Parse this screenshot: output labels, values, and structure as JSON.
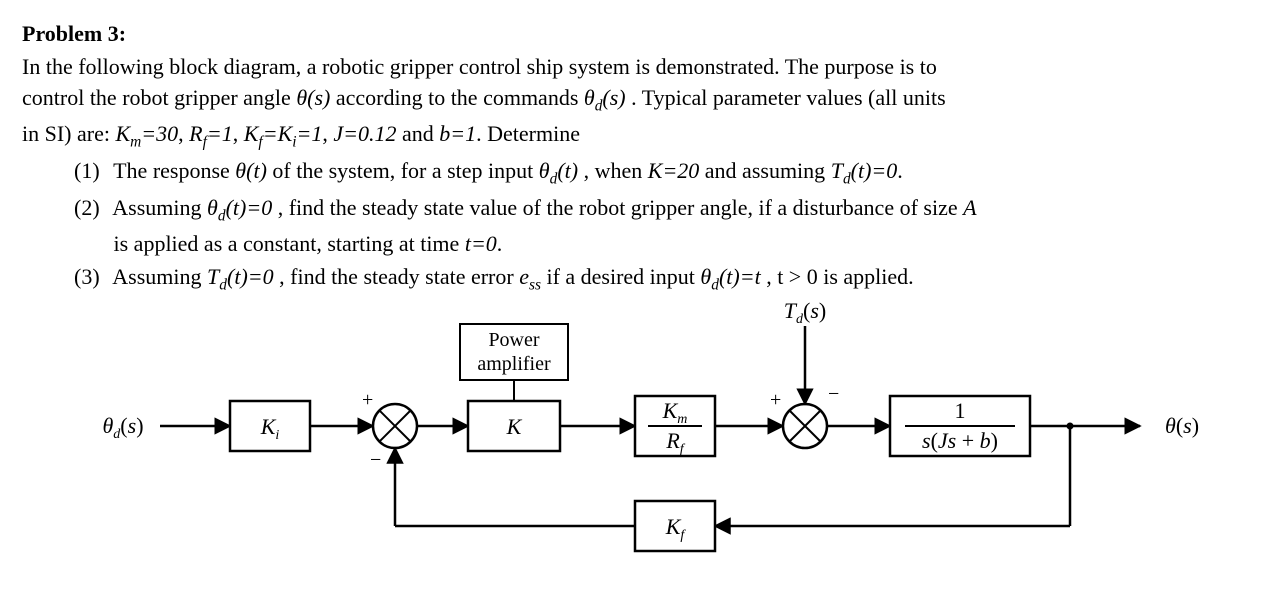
{
  "title": "Problem 3:",
  "para_line1_a": "In the following block diagram, a robotic gripper control ship system is demonstrated. The purpose is to",
  "para_line2_a": "control the robot gripper angle ",
  "para_line2_theta_s": "θ(s)",
  "para_line2_b": " according to the commands ",
  "para_line2_theta_d_s": "θ_d(s)",
  "para_line2_c": ". Typical parameter values (all units",
  "para_line3_a": "in SI) are: ",
  "params": {
    "Km": "K_m=30",
    "Rf": "R_f=1",
    "KfKi": "K_f=K_i=1",
    "J": "J=0.12",
    "b": "b=1"
  },
  "para_line3_b": ". Determine",
  "q1": {
    "num": "(1)",
    "a": "The response ",
    "theta_t": "θ(t)",
    "b": " of the system, for a step input ",
    "theta_d_t": "θ_d(t)",
    "c": ", when ",
    "K20": "K=20",
    "d": " and assuming ",
    "Td0": "T_d(t)=0",
    "e": "."
  },
  "q2": {
    "num": "(2)",
    "a": "Assuming ",
    "theta_d0": "θ_d(t)=0",
    "b": ", find the steady state value of the robot gripper angle, if a disturbance of size ",
    "A": "A",
    "line2": "is applied as a constant, starting at time ",
    "t0": "t=0",
    "dot": "."
  },
  "q3": {
    "num": "(3)",
    "a": "Assuming ",
    "Td0": "T_d(t)=0",
    "b": ", find the steady state error ",
    "ess": "e_ss",
    "c": " if a desired input ",
    "theta_d_t": "θ_d(t)=t",
    "d": ", t > 0 is applied."
  },
  "diagram": {
    "input_label": "θ_d(s)",
    "Ki": "K_i",
    "sum1": {
      "plus": "+",
      "minus": "−"
    },
    "amp_top": "Power",
    "amp_bot": "amplifier",
    "K": "K",
    "Km_over_Rf_top": "K_m",
    "Km_over_Rf_bot": "R_f",
    "sum2": {
      "plus": "+",
      "minus": "−"
    },
    "Td_label": "T_d(s)",
    "plant_top": "1",
    "plant_bot": "s(Js + b)",
    "output_label": "θ(s)",
    "Kf": "K_f"
  },
  "chart_data": {
    "type": "block-diagram",
    "signals": {
      "input": "θ_d(s)",
      "disturbance": "T_d(s)",
      "output": "θ(s)"
    },
    "forward_path": [
      {
        "block": "K_i"
      },
      {
        "sum": {
          "inputs": [
            "+ (from K_i)",
            "− (feedback from K_f)"
          ]
        }
      },
      {
        "block": "K",
        "label": "Power amplifier"
      },
      {
        "block": "K_m / R_f"
      },
      {
        "sum": {
          "inputs": [
            "+ (from K_m/R_f)",
            "− T_d(s)"
          ]
        }
      },
      {
        "block": "1 / ( s (J s + b) )"
      }
    ],
    "feedback_path": [
      {
        "block": "K_f",
        "from": "θ(s)",
        "to": "negative input of first summing junction"
      }
    ],
    "parameters": {
      "K_m": 30,
      "R_f": 1,
      "K_f": 1,
      "K_i": 1,
      "J": 0.12,
      "b": 1,
      "K": 20
    }
  }
}
